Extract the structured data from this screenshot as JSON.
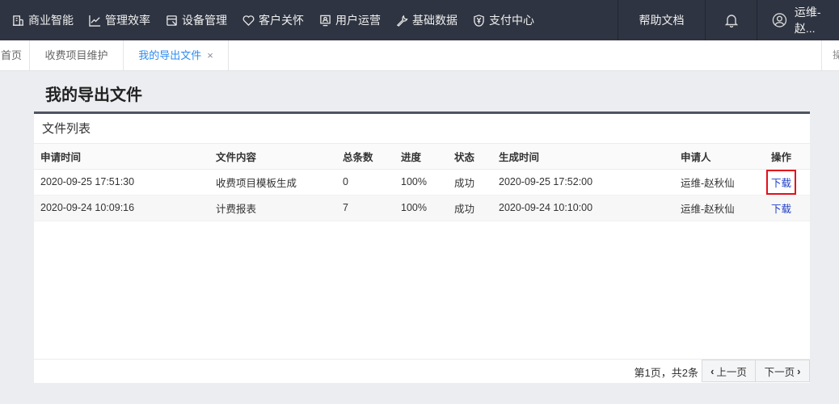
{
  "nav": {
    "items": [
      {
        "label": "商业智能",
        "icon": "bi-icon"
      },
      {
        "label": "管理效率",
        "icon": "chart-line-icon"
      },
      {
        "label": "设备管理",
        "icon": "device-icon"
      },
      {
        "label": "客户关怀",
        "icon": "heart-icon"
      },
      {
        "label": "用户运营",
        "icon": "user-ops-icon"
      },
      {
        "label": "基础数据",
        "icon": "wrench-icon"
      },
      {
        "label": "支付中心",
        "icon": "shield-yen-icon"
      }
    ],
    "help": "帮助文档",
    "user": "运维-赵..."
  },
  "tabs": {
    "home": "首页",
    "fee": "收费项目维护",
    "export": "我的导出文件",
    "close": "×",
    "right_ctl": "操"
  },
  "page": {
    "title": "我的导出文件",
    "panel_title": "文件列表"
  },
  "table": {
    "headers": [
      "申请时间",
      "文件内容",
      "总条数",
      "进度",
      "状态",
      "生成时间",
      "申请人",
      "操作"
    ],
    "rows": [
      [
        "2020-09-25 17:51:30",
        "收费项目模板生成",
        "0",
        "100%",
        "成功",
        "2020-09-25 17:52:00",
        "运维-赵秋仙",
        "下载"
      ],
      [
        "2020-09-24 10:09:16",
        "计费报表",
        "7",
        "100%",
        "成功",
        "2020-09-24 10:10:00",
        "运维-赵秋仙",
        "下载"
      ]
    ]
  },
  "pager": {
    "info": "第1页，共2条",
    "prev": "上一页",
    "next": "下一页"
  },
  "colors": {
    "nav_bg": "#2e3441",
    "active_tab": "#2d8cf0",
    "link": "#1f3fc7",
    "highlight": "#e3101b"
  }
}
